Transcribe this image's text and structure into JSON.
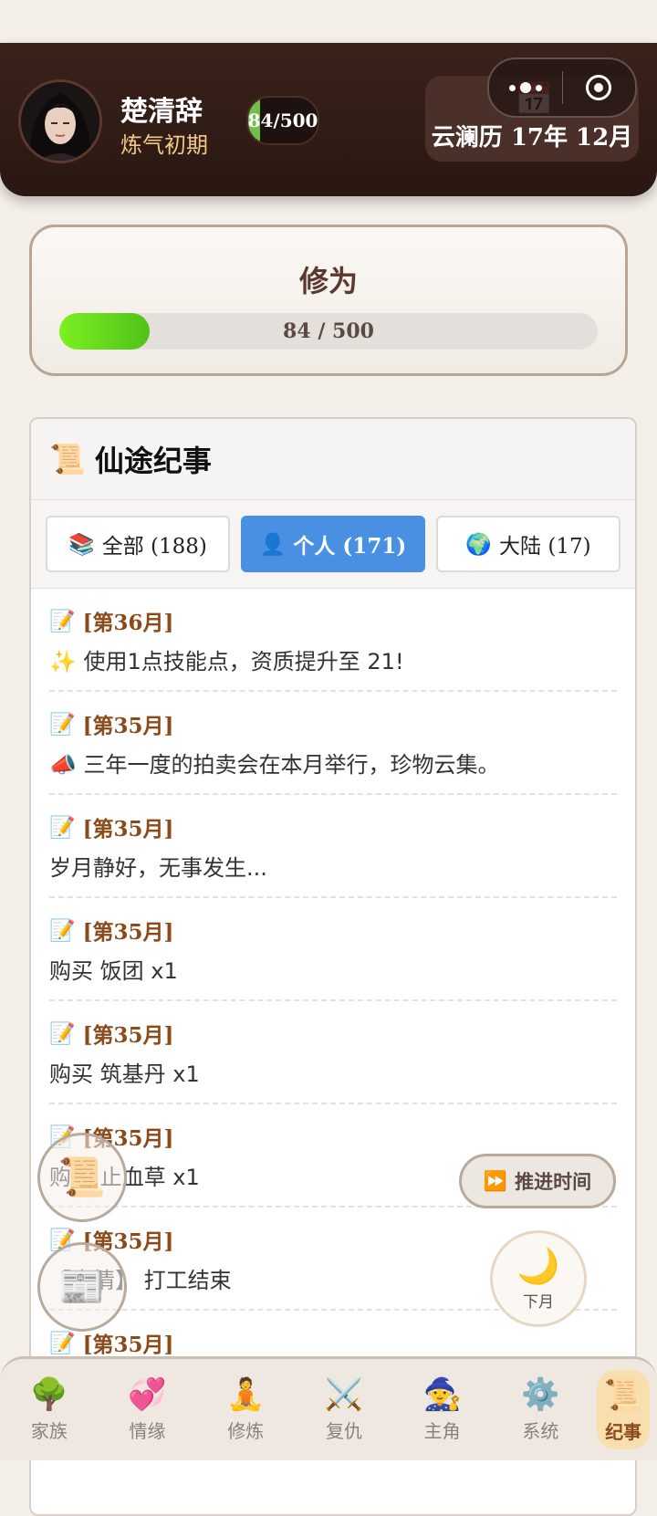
{
  "header": {
    "name": "楚清辞",
    "realm": "炼气初期",
    "cultivation_pill": "84/500",
    "cultivation_fraction": 0.168,
    "date": "云澜历 17年 12月",
    "calendar_icon": "📅"
  },
  "cultivation": {
    "title": "修为",
    "current": 84,
    "max": 500,
    "progress_text": "84 / 500",
    "bar_color": "#6fe01e"
  },
  "chronicle": {
    "icon": "📜",
    "title": "仙途纪事",
    "tabs": [
      {
        "icon": "📚",
        "label": "全部 (188)",
        "active": false
      },
      {
        "icon": "👤",
        "label": "个人 (171)",
        "active": true
      },
      {
        "icon": "🌍",
        "label": "大陆 (17)",
        "active": false
      }
    ],
    "entries": [
      {
        "icon": "📝",
        "month": "[第36月]",
        "text": "✨ 使用1点技能点，资质提升至 21!"
      },
      {
        "icon": "📝",
        "month": "[第35月]",
        "text": "📣 三年一度的拍卖会在本月举行，珍物云集。"
      },
      {
        "icon": "📝",
        "month": "[第35月]",
        "text": "岁月静好，无事发生..."
      },
      {
        "icon": "📝",
        "month": "[第35月]",
        "text": "购买 饭团 x1"
      },
      {
        "icon": "📝",
        "month": "[第35月]",
        "text": "购买 筑基丹 x1"
      },
      {
        "icon": "📝",
        "month": "[第35月]",
        "text": "购买 止血草 x1"
      },
      {
        "icon": "📝",
        "month": "[第35月]",
        "text": "【事情】 打工结束"
      },
      {
        "icon": "📝",
        "month": "[第35月]",
        "text": ""
      }
    ]
  },
  "floating": {
    "scroll_icon": "📜",
    "news_icon": "📰",
    "advance_icon": "⏩",
    "advance_label": "推进时间",
    "next_icon": "🌙",
    "next_label": "下月"
  },
  "nav": [
    {
      "icon": "🌳",
      "label": "家族",
      "active": false
    },
    {
      "icon": "💞",
      "label": "情缘",
      "active": false
    },
    {
      "icon": "🧘",
      "label": "修炼",
      "active": false
    },
    {
      "icon": "⚔️",
      "label": "复仇",
      "active": false
    },
    {
      "icon": "🧙",
      "label": "主角",
      "active": false
    },
    {
      "icon": "⚙️",
      "label": "系统",
      "active": false
    },
    {
      "icon": "📜",
      "label": "纪事",
      "active": true
    }
  ]
}
